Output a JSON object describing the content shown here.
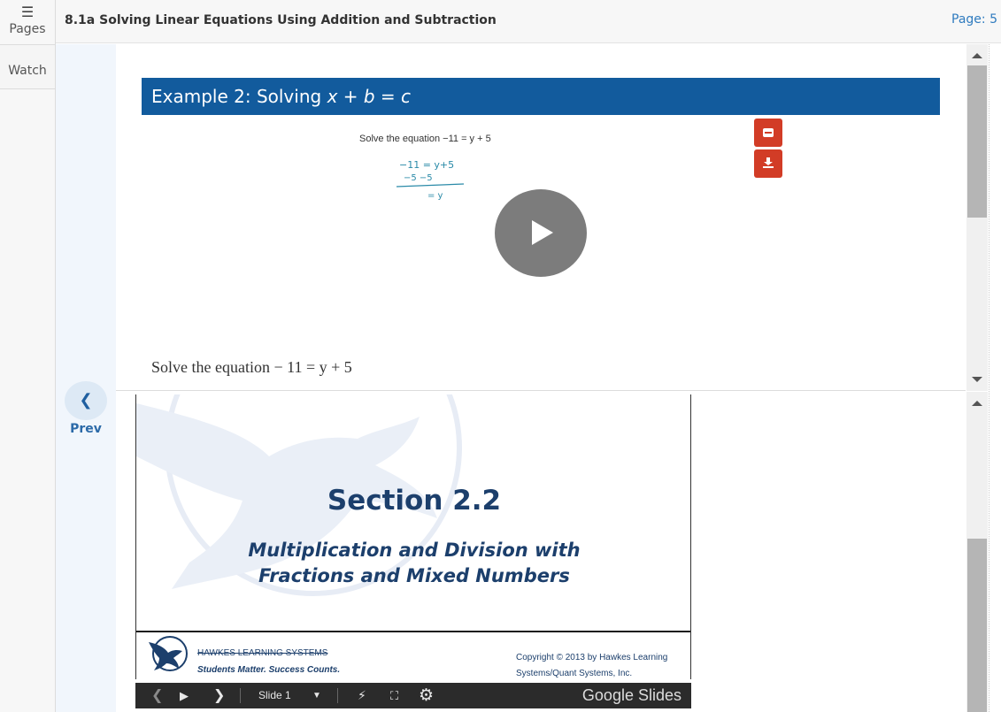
{
  "nav": {
    "pages_label": "Pages",
    "watch_label": "Watch",
    "prev_label": "Prev",
    "menu_icon": "hamburger-icon",
    "prev_icon": "chevron-left-icon"
  },
  "header": {
    "title": "8.1a Solving Linear Equations Using Addition and Subtraction",
    "page_label": "Page: 5"
  },
  "example": {
    "title_prefix": "Example 2: Solving ",
    "title_formula": "x + b = c",
    "video_prompt": "Solve the equation −11 = y + 5",
    "handwriting": [
      "−11 = y+5",
      "−5    −5",
      "= y"
    ],
    "equation_text": "Solve the equation − 11  =  y + 5",
    "colors": {
      "banner": "#125b9d",
      "action_buttons": "#d23c26",
      "play": "#7c7c7c"
    }
  },
  "slides": {
    "section_title": "Section 2.2",
    "subtitle_line1": "Multiplication and Division with",
    "subtitle_line2": "Fractions and Mixed Numbers",
    "brand": "HAWKES LEARNING SYSTEMS",
    "tagline": "Students Matter. Success Counts.",
    "copyright_line1": "Copyright © 2013 by Hawkes Learning",
    "copyright_line2": "Systems/Quant Systems, Inc.",
    "controls": {
      "slide_label": "Slide 1",
      "provider": "Google Slides"
    }
  }
}
